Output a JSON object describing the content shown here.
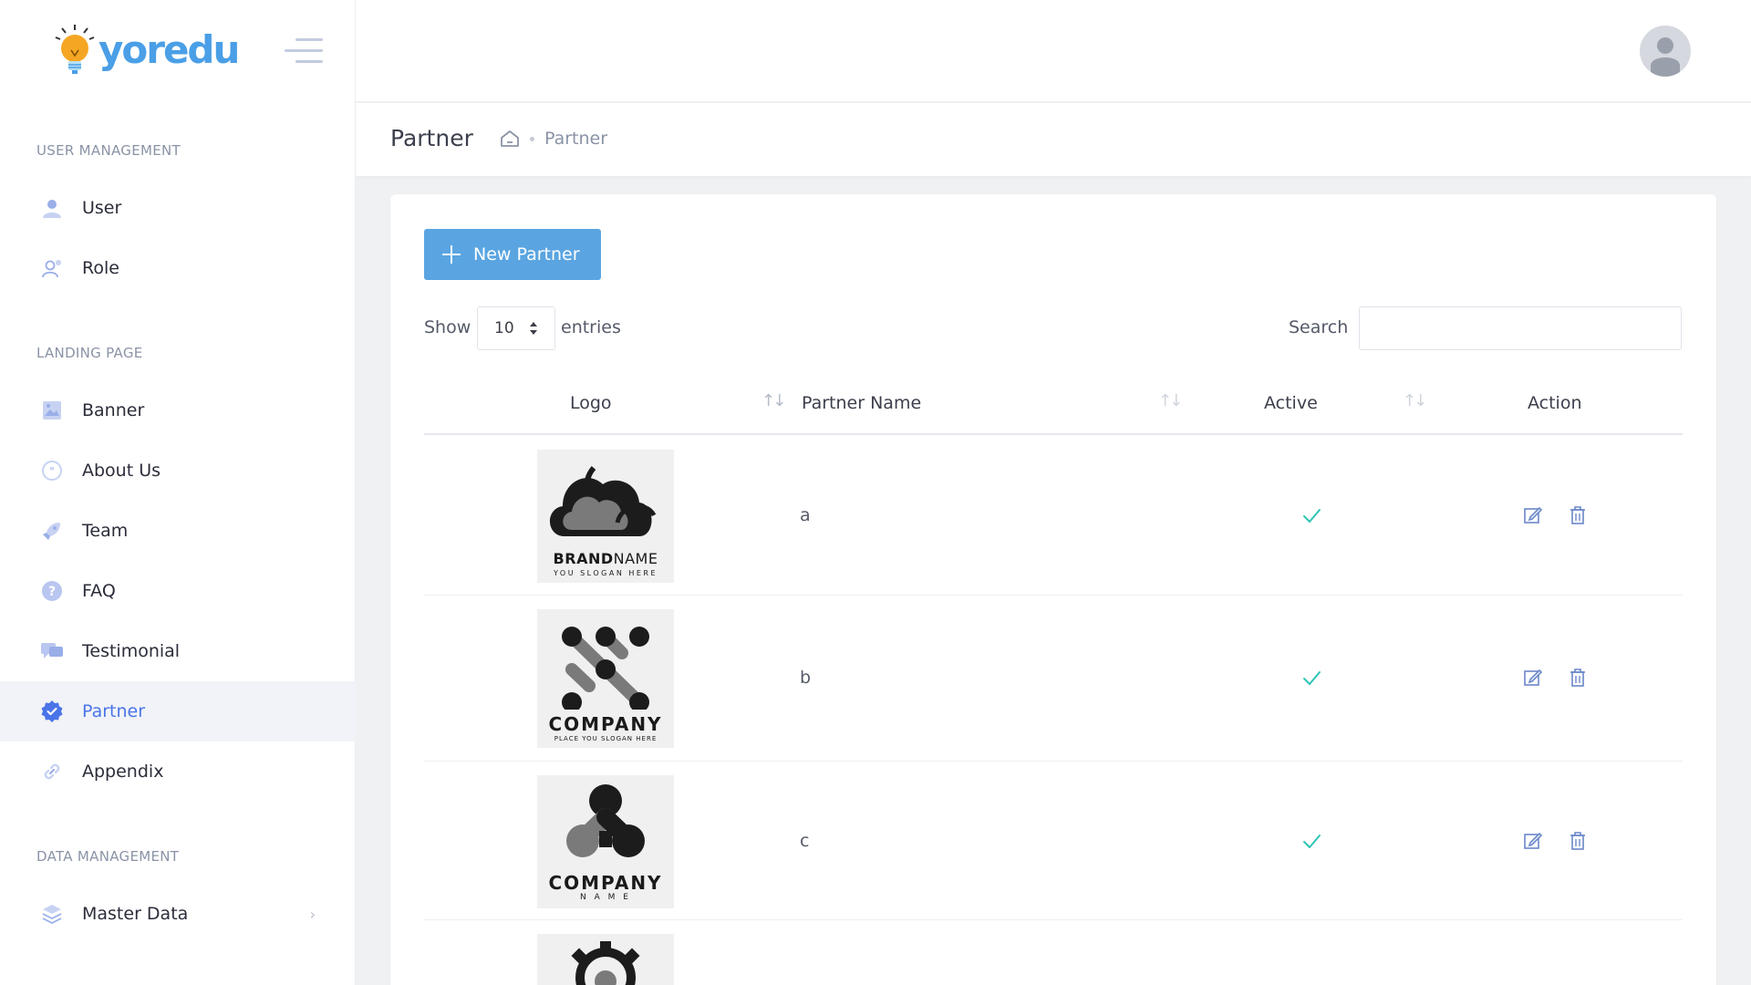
{
  "brand": {
    "name": "yoredu"
  },
  "sidebar": {
    "sections": [
      {
        "title": "USER MANAGEMENT"
      },
      {
        "title": "LANDING PAGE"
      },
      {
        "title": "DATA MANAGEMENT"
      }
    ],
    "items": [
      {
        "label": "User",
        "icon": "user-icon"
      },
      {
        "label": "Role",
        "icon": "role-icon"
      },
      {
        "label": "Banner",
        "icon": "banner-icon"
      },
      {
        "label": "About Us",
        "icon": "quote-icon"
      },
      {
        "label": "Team",
        "icon": "rocket-icon"
      },
      {
        "label": "FAQ",
        "icon": "question-icon"
      },
      {
        "label": "Testimonial",
        "icon": "chat-icon"
      },
      {
        "label": "Partner",
        "icon": "badge-check-icon",
        "active": true
      },
      {
        "label": "Appendix",
        "icon": "link-icon"
      },
      {
        "label": "Master Data",
        "icon": "layers-icon"
      }
    ]
  },
  "header": {
    "title": "Partner",
    "breadcrumb": {
      "current": "Partner"
    }
  },
  "toolbar": {
    "new_label": "New Partner",
    "show_label": "Show",
    "entries_value": "10",
    "entries_label": "entries",
    "search_label": "Search",
    "search_value": ""
  },
  "table": {
    "columns": [
      "Logo",
      "Partner Name",
      "Active",
      "Action"
    ],
    "rows": [
      {
        "name": "a",
        "active": true,
        "logo_title_bold": "BRAND",
        "logo_title_rest": "NAME",
        "logo_sub": "YOU SLOGAN HERE"
      },
      {
        "name": "b",
        "active": true,
        "logo_title": "COMPANY",
        "logo_sub": "PLACE YOU SLOGAN HERE"
      },
      {
        "name": "c",
        "active": true,
        "logo_title": "COMPANY",
        "logo_sub": "N A M E"
      },
      {
        "name": "",
        "active": true
      }
    ]
  },
  "colors": {
    "accent": "#4a74e8",
    "button": "#5aa5e1",
    "check": "#2ec4b6"
  }
}
